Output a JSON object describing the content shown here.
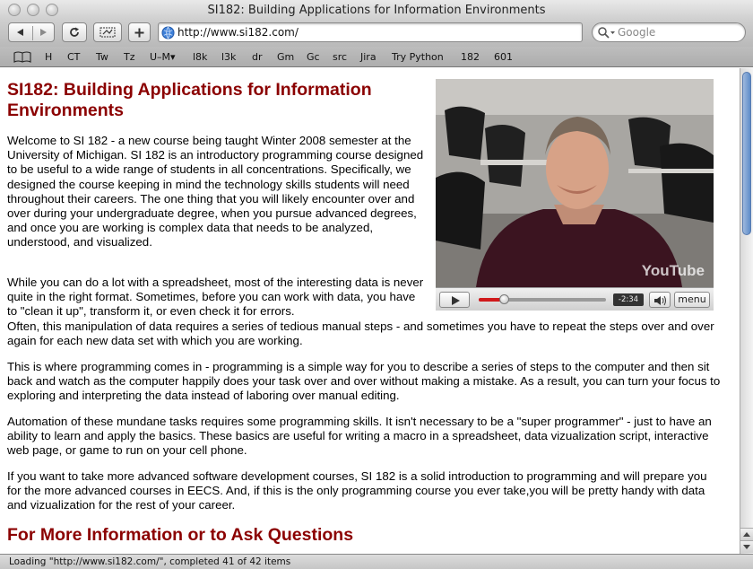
{
  "window": {
    "title": "SI182: Building Applications for Information Environments"
  },
  "toolbar": {
    "url": "http://www.si182.com/",
    "search_placeholder": "Google"
  },
  "bookmarks": [
    "H",
    "CT",
    "Tw",
    "Tz",
    "U–M▾",
    "l8k",
    "l3k",
    "dr",
    "Gm",
    "Gc",
    "src",
    "Jira",
    "Try Python",
    "182",
    "601"
  ],
  "page": {
    "title": "SI182: Building Applications for Information Environments",
    "paragraphs": [
      "Welcome to SI 182 - a new course being taught Winter 2008 semester at the University of Michigan. SI 182 is an introductory programming course designed to be useful to a wide range of students in all concentrations. Specifically, we designed the course keeping in mind the technology skills students will need throughout their careers. The one thing that you will likely encounter over and over during your undergraduate degree, when you pursue advanced degrees, and once you are working is complex data that needs to be analyzed, understood, and visualized.",
      "While you can do a lot with a spreadsheet, most of the interesting data is never quite in the right format. Sometimes, before you can work with data, you have to \"clean it up\", transform it, or even check it for errors.",
      "Often, this manipulation of data requires a series of tedious manual steps - and sometimes you have to repeat the steps over and over again for each new data set with which you are working.",
      "This is where programming comes in - programming is a simple way for you to describe a series of steps to the computer and then sit back and watch as the computer happily does your task over and over without making a mistake. As a result, you can turn your focus to exploring and interpreting the data instead of laboring over manual editing.",
      "Automation of these mundane tasks requires some programming skills. It isn't necessary to be a \"super programmer\" - just to have an ability to learn and apply the basics. These basics are useful for writing a macro in a spreadsheet, data vizualization script, interactive web page, or game to run on your cell phone.",
      "If you want to take more advanced software development courses, SI 182 is a solid introduction to programming and will prepare you for the more advanced courses in EECS. And, if this is the only programming course you ever take,you will be pretty handy with data and vizualization for the rest of your career."
    ],
    "section_title": "For More Information or to Ask Questions"
  },
  "video": {
    "logo": "YouTube",
    "time": "-2:34",
    "menu_label": "menu",
    "progress": 0.2
  },
  "status": {
    "text": "Loading \"http://www.si182.com/\", completed 41 of 42 items"
  }
}
